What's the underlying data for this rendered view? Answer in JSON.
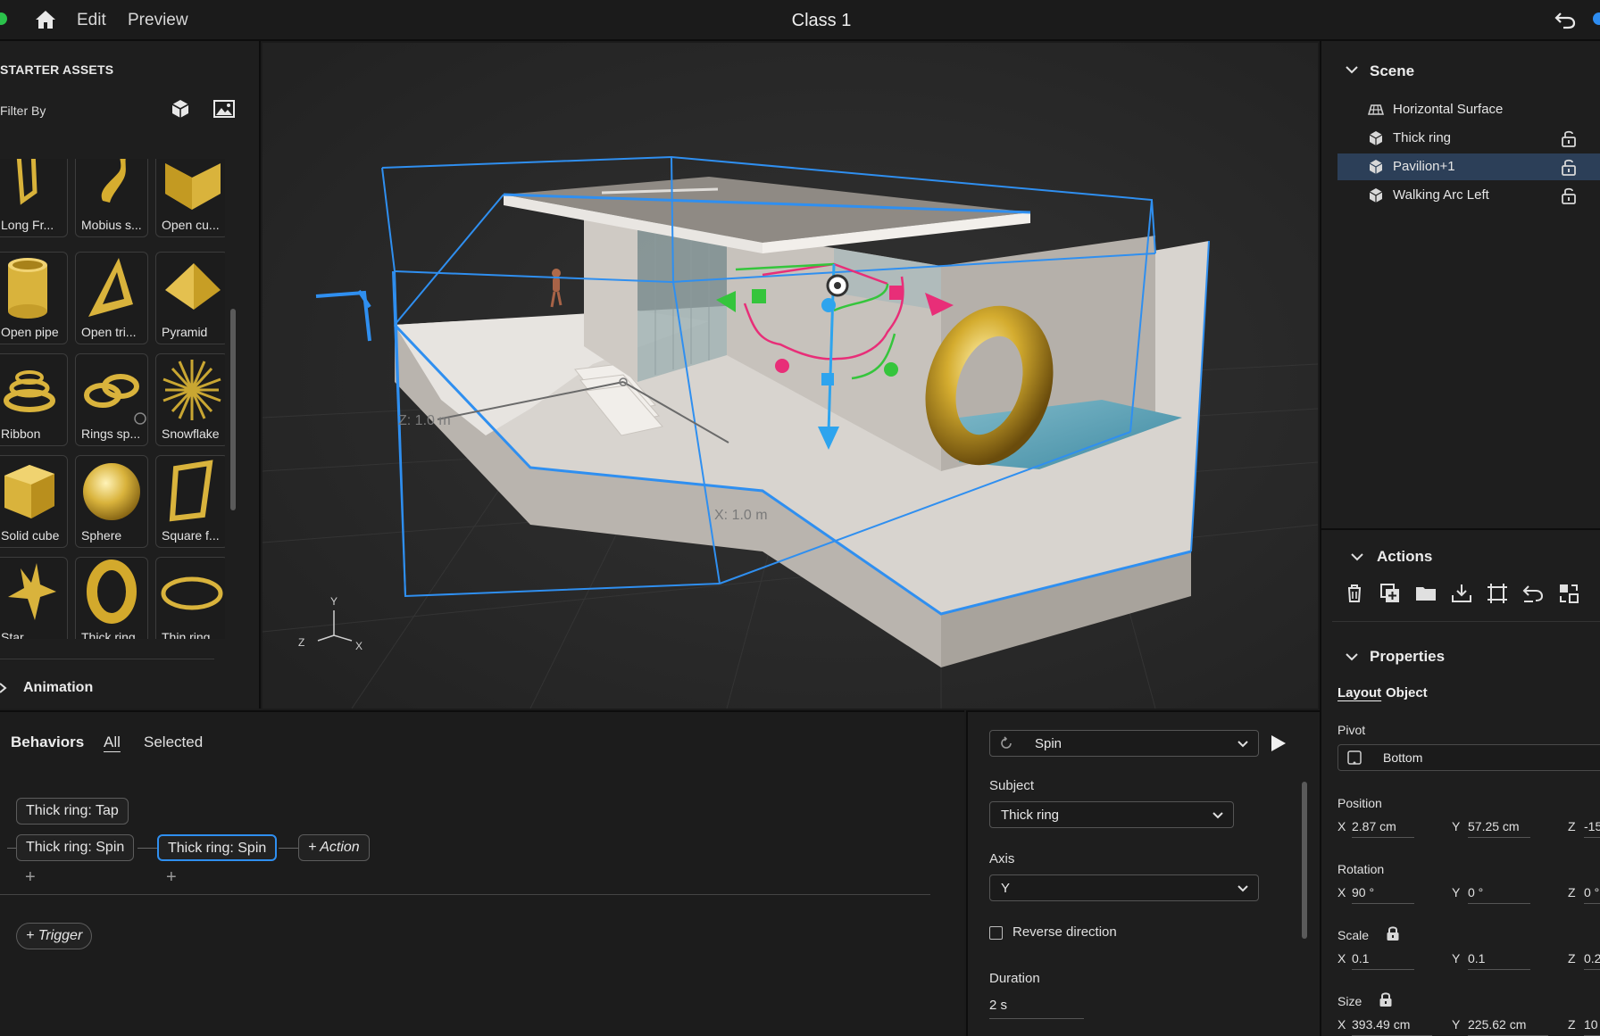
{
  "topbar": {
    "menu_edit": "Edit",
    "menu_preview": "Preview",
    "title": "Class 1"
  },
  "assets": {
    "heading": "STARTER ASSETS",
    "filter_label": "Filter By",
    "items": [
      {
        "label": "Long Fr...",
        "icon": "long-frame-icon"
      },
      {
        "label": "Mobius s...",
        "icon": "mobius-strip-icon"
      },
      {
        "label": "Open cu...",
        "icon": "open-cube-icon"
      },
      {
        "label": "Open pipe",
        "icon": "open-pipe-icon"
      },
      {
        "label": "Open tri...",
        "icon": "open-triangle-icon"
      },
      {
        "label": "Pyramid",
        "icon": "pyramid-icon"
      },
      {
        "label": "Ribbon",
        "icon": "ribbon-icon"
      },
      {
        "label": "Rings sp...",
        "icon": "rings-spiral-icon"
      },
      {
        "label": "Snowflake",
        "icon": "snowflake-icon"
      },
      {
        "label": "Solid cube",
        "icon": "solid-cube-icon"
      },
      {
        "label": "Sphere",
        "icon": "sphere-icon"
      },
      {
        "label": "Square f...",
        "icon": "square-frame-icon"
      },
      {
        "label": "Star",
        "icon": "star-icon"
      },
      {
        "label": "Thick ring",
        "icon": "thick-ring-icon"
      },
      {
        "label": "Thin ring",
        "icon": "thin-ring-icon"
      }
    ],
    "animation_label": "Animation"
  },
  "viewport": {
    "z_measure": "Z:  1.0 m",
    "x_measure": "X:  1.0 m",
    "axis_y": "Y",
    "axis_x": "X",
    "axis_z": "Z"
  },
  "scene": {
    "heading": "Scene",
    "items": [
      {
        "label": "Horizontal Surface",
        "icon": "surface-icon",
        "locked": false,
        "selected": false
      },
      {
        "label": "Thick ring",
        "icon": "object-cube-icon",
        "locked": true,
        "selected": false
      },
      {
        "label": "Pavilion+1",
        "icon": "object-cube-icon",
        "locked": true,
        "selected": true
      },
      {
        "label": "Walking Arc Left",
        "icon": "object-cube-icon",
        "locked": true,
        "selected": false
      }
    ]
  },
  "actions": {
    "heading": "Actions",
    "icons": [
      "delete-icon",
      "duplicate-icon",
      "folder-icon",
      "download-icon",
      "crop-frame-icon",
      "reset-icon",
      "replace-icon"
    ]
  },
  "properties": {
    "heading": "Properties",
    "tab_layout": "Layout",
    "tab_object": "Object",
    "pivot_label": "Pivot",
    "pivot_value": "Bottom",
    "position_label": "Position",
    "position": {
      "x": "2.87 cm",
      "y": "57.25 cm",
      "z": "-15"
    },
    "rotation_label": "Rotation",
    "rotation": {
      "x": "90 °",
      "y": "0 °",
      "z": "0 °"
    },
    "scale_label": "Scale",
    "scale": {
      "x": "0.1",
      "y": "0.1",
      "z": "0.2"
    },
    "size_label": "Size",
    "size": {
      "x": "393.49 cm",
      "y": "225.62 cm",
      "z": "10"
    },
    "axis_x": "X",
    "axis_y": "Y",
    "axis_z": "Z"
  },
  "behaviors": {
    "heading": "Behaviors",
    "tab_all": "All",
    "tab_selected": "Selected",
    "trigger_chip": "Thick ring: Tap",
    "action_chip_1": "Thick ring: Spin",
    "action_chip_2": "Thick ring: Spin",
    "add_action": "+ Action",
    "add_trigger": "+ Trigger",
    "plus": "+"
  },
  "action_props": {
    "action_type": "Spin",
    "subject_label": "Subject",
    "subject_value": "Thick ring",
    "axis_label": "Axis",
    "axis_value": "Y",
    "reverse_label": "Reverse direction",
    "reverse_checked": false,
    "duration_label": "Duration",
    "duration_value": "2 s"
  },
  "colors": {
    "selection_blue": "#2f8ff0",
    "gizmo_green": "#35c53c",
    "gizmo_pink": "#ea2e79",
    "gizmo_blue": "#2ea4ee",
    "gold": "#d9b53a"
  }
}
